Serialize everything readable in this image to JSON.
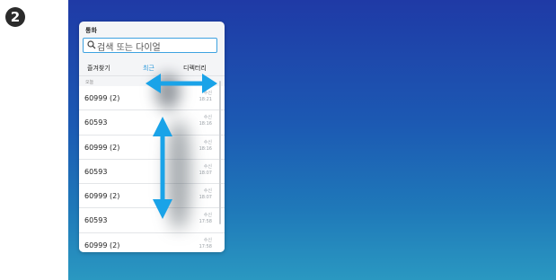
{
  "step_badge": "2",
  "panel": {
    "title": "통화",
    "search": {
      "placeholder": "검색 또는 다이얼"
    },
    "tabs": [
      {
        "label": "즐겨찾기",
        "active": false
      },
      {
        "label": "최근",
        "active": true
      },
      {
        "label": "디렉터리",
        "active": false
      }
    ],
    "date_header": "오늘",
    "calls": [
      {
        "number": "60999 (2)",
        "status": "수신",
        "time": "18:21"
      },
      {
        "number": "60593",
        "status": "수신",
        "time": "18:16"
      },
      {
        "number": "60999 (2)",
        "status": "수신",
        "time": "18:16"
      },
      {
        "number": "60593",
        "status": "수신",
        "time": "18:07"
      },
      {
        "number": "60999 (2)",
        "status": "수신",
        "time": "18:07"
      },
      {
        "number": "60593",
        "status": "수신",
        "time": "17:58"
      },
      {
        "number": "60999 (2)",
        "status": "수신",
        "time": "17:58"
      }
    ]
  },
  "colors": {
    "accent": "#2f9bdc",
    "arrow": "#1aa3e8",
    "background_top": "#1f3aa6",
    "background_bottom": "#2a98c1"
  },
  "icons": [
    "search-icon",
    "horizontal-swipe-arrow-icon",
    "vertical-swipe-arrow-icon"
  ]
}
